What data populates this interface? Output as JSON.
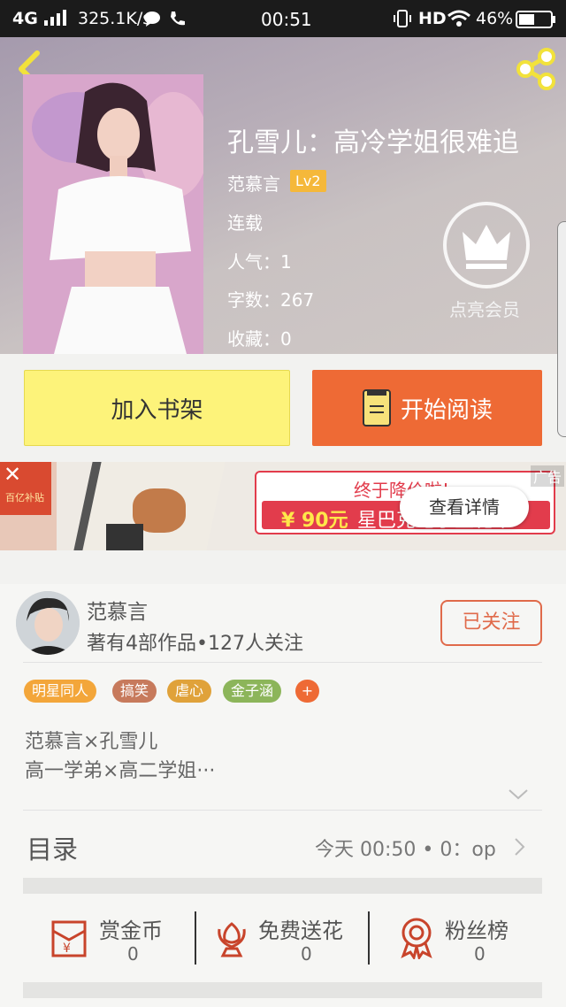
{
  "status": {
    "network": "4G",
    "speed": "325.1K/s",
    "time": "00:51",
    "hd": "HD",
    "battery": "46%"
  },
  "book": {
    "title": "孔雪儿：高冷学姐很难追",
    "author": "范慕言",
    "level": "Lv2",
    "state": "连载",
    "popularity": "人气：1",
    "words": "字数：267",
    "favorites": "收藏：0"
  },
  "vip": {
    "label": "点亮会员"
  },
  "actions": {
    "add_shelf": "加入书架",
    "start_read": "开始阅读"
  },
  "ad": {
    "label": "广告",
    "headline": "终于降价啦!",
    "price": "¥ 90元",
    "promo": "星巴克电子生花卡",
    "detail": "查看详情",
    "app": "百亿补贴"
  },
  "author_card": {
    "name": "范慕言",
    "meta": "著有4部作品•127人关注",
    "follow": "已关注"
  },
  "tags": [
    {
      "label": "明星同人",
      "color": "#f3a63a"
    },
    {
      "label": "搞笑",
      "color": "#c77a5c"
    },
    {
      "label": "虐心",
      "color": "#e0a23a"
    },
    {
      "label": "金子涵",
      "color": "#8cb55a"
    },
    {
      "label": "+",
      "color": "#ee6a35"
    }
  ],
  "intro": {
    "line1": "范慕言×孔雪儿",
    "line2": "高一学弟×高二学姐···"
  },
  "toc": {
    "label": "目录",
    "latest": "今天 00:50 • 0：op"
  },
  "stats": [
    {
      "label": "赏金币",
      "value": "0"
    },
    {
      "label": "免费送花",
      "value": "0"
    },
    {
      "label": "粉丝榜",
      "value": "0"
    }
  ]
}
